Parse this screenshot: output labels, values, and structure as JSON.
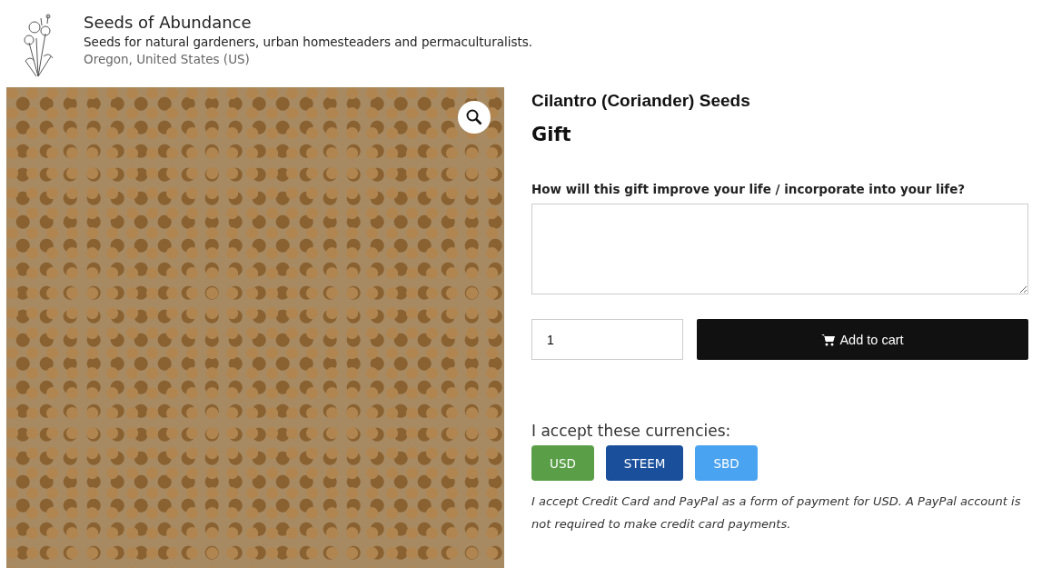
{
  "site": {
    "name": "Seeds of Abundance",
    "tagline": "Seeds for natural gardeners, urban homesteaders and permaculturalists.",
    "location": "Oregon, United States (US)"
  },
  "product": {
    "title": "Cilantro (Coriander) Seeds",
    "subtitle": "Gift",
    "question": "How will this gift improve your life / incorporate into your life?",
    "quantity": "1",
    "add_to_cart": "Add to cart"
  },
  "currencies": {
    "heading": "I accept these currencies:",
    "items": [
      {
        "label": "USD",
        "color": "#5a9e47"
      },
      {
        "label": "STEEM",
        "color": "#1a4f9b"
      },
      {
        "label": "SBD",
        "color": "#4aa3f0"
      }
    ],
    "note": "I accept Credit Card and PayPal as a form of payment for USD. A PayPal account is not required to make credit card payments."
  }
}
